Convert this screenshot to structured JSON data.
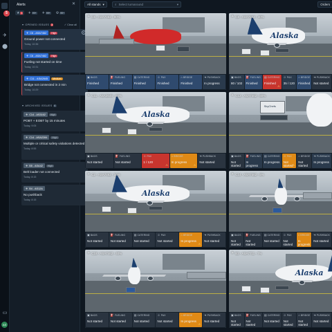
{
  "app": {
    "panel_title": "Alerts"
  },
  "filters": [
    {
      "icon": "star-icon",
      "count": "1",
      "red": true
    },
    {
      "icon": "plane-icon",
      "count": "99+",
      "red": false
    },
    {
      "icon": "plane-icon",
      "count": "99+",
      "red": false
    },
    {
      "icon": "gear-icon",
      "count": "99+",
      "red": false
    }
  ],
  "rail": {
    "badge": "5",
    "avatar": "AS"
  },
  "opened": {
    "title": "OPENED ISSUES",
    "count": "3",
    "clear_all": "Clear all",
    "items": [
      {
        "tag": "C6 - ASA7462",
        "priority": "High",
        "priority_class": "high",
        "message": "Ground power not connected",
        "time": "Today, 10:36"
      },
      {
        "tag": "C6 - ASA7462",
        "priority": "High",
        "priority_class": "high",
        "message": "Fueling not started on time",
        "time": "Today, 10:31"
      },
      {
        "tag": "C11 - ASA2645",
        "priority": "Medium",
        "priority_class": "medium",
        "message": "Bridge not connected in 2 min",
        "time": "Today, 10:29"
      }
    ]
  },
  "archived": {
    "title": "ARCHIVED ISSUES",
    "count": "6",
    "items": [
      {
        "tag": "C14 - AS3162",
        "priority": "High",
        "message": "POBT + EOBT by 15 minutes",
        "time": "Today, 9:05"
      },
      {
        "tag": "C14 - ASA2284",
        "priority": "High",
        "message": "Multiple or critical safety violations detected",
        "time": "Today, 8:55"
      },
      {
        "tag": "B5 - ASA42",
        "priority": "High",
        "message": "Belt loader not connected",
        "time": "Today, 8:15"
      },
      {
        "tag": "B4 - AS12A",
        "priority": "",
        "message": "No pushback",
        "time": "Today, 8:15"
      }
    ]
  },
  "topbar": {
    "stands": "All stands",
    "search_placeholder": "Select turnaround",
    "order": "Orders"
  },
  "tiles": [
    {
      "label": "C6 - ASA7462 - 90%",
      "scene": "red",
      "statuses": [
        {
          "key": "BAGS",
          "value": "Finished",
          "state": "finished"
        },
        {
          "key": "FUELING",
          "value": "Finished",
          "state": "finished"
        },
        {
          "key": "CATERING",
          "value": "Finished",
          "state": "finished"
        },
        {
          "key": "PAX",
          "value": "Finished",
          "state": "finished"
        },
        {
          "key": "BRIDGE",
          "value": "Finished",
          "state": "finished"
        },
        {
          "key": "PUSHBACK",
          "value": "In progress",
          "state": "inprogress"
        }
      ]
    },
    {
      "label": "C8 - ASA7462 - 40%",
      "scene": "alaska-tail",
      "statuses": [
        {
          "key": "BAGS",
          "value": "80 / 102",
          "state": "inprogress"
        },
        {
          "key": "FUELING",
          "value": "Finished",
          "state": "finished"
        },
        {
          "key": "CATERING",
          "value": "Finished",
          "state": "alert"
        },
        {
          "key": "PAX",
          "value": "35 / 120",
          "state": "inprogress"
        },
        {
          "key": "BRIDGE",
          "value": "Finished",
          "state": "finished"
        },
        {
          "key": "PUSHBACK",
          "value": "Not started",
          "state": "notstarted"
        }
      ]
    },
    {
      "label": "C11 - ASA2645 - 60%",
      "scene": "alaska",
      "statuses": [
        {
          "key": "BAGS",
          "value": "Not started",
          "state": "notstarted"
        },
        {
          "key": "FUELING",
          "value": "Not started",
          "state": "notstarted"
        },
        {
          "key": "PAX",
          "value": "1 / 120",
          "state": "alert"
        },
        {
          "key": "BRIDGE",
          "value": "In progress",
          "state": "warn"
        },
        {
          "key": "PUSHBACK",
          "value": "Not started",
          "state": "notstarted"
        }
      ]
    },
    {
      "label": "C12 - ASA7462 - 80%",
      "scene": "skychef",
      "statuses": [
        {
          "key": "BAGS",
          "value": "Not started",
          "state": "notstarted"
        },
        {
          "key": "FUELING",
          "value": "In progress",
          "state": "inprogress"
        },
        {
          "key": "CATERING",
          "value": "In progress",
          "state": "inprogress"
        },
        {
          "key": "PAX",
          "value": "Not started",
          "state": "warn"
        },
        {
          "key": "BRIDGE",
          "value": "Not started",
          "state": "notstarted"
        },
        {
          "key": "PUSHBACK",
          "value": "In progress",
          "state": "inprogress"
        }
      ]
    },
    {
      "label": "C2 - ASA7462 - 34%",
      "scene": "alaska-side",
      "statuses": [
        {
          "key": "BAGS",
          "value": "Not started",
          "state": "notstarted"
        },
        {
          "key": "FUELING",
          "value": "Not started",
          "state": "notstarted"
        },
        {
          "key": "CATERING",
          "value": "Not started",
          "state": "notstarted"
        },
        {
          "key": "PAX",
          "value": "Not started",
          "state": "notstarted"
        },
        {
          "key": "BRIDGE",
          "value": "In progress",
          "state": "warn"
        },
        {
          "key": "PUSHBACK",
          "value": "Not started",
          "state": "notstarted"
        }
      ]
    },
    {
      "label": "C14 - ASA7462 - 5%",
      "scene": "front",
      "statuses": [
        {
          "key": "BAGS",
          "value": "Not started",
          "state": "notstarted"
        },
        {
          "key": "FUELING",
          "value": "Not started",
          "state": "notstarted"
        },
        {
          "key": "CATERING",
          "value": "Not started",
          "state": "notstarted"
        },
        {
          "key": "PAX",
          "value": "Not started",
          "state": "notstarted"
        },
        {
          "key": "BRIDGE",
          "value": "In progress",
          "state": "warn"
        },
        {
          "key": "PUSHBACK",
          "value": "Not started",
          "state": "notstarted"
        }
      ]
    },
    {
      "label": "C18 - ASA7462 - 40%",
      "scene": "front-left",
      "statuses": [
        {
          "key": "BAGS",
          "value": "Not started",
          "state": "notstarted"
        },
        {
          "key": "FUELING",
          "value": "Not started",
          "state": "notstarted"
        },
        {
          "key": "CATERING",
          "value": "Not started",
          "state": "notstarted"
        },
        {
          "key": "PAX",
          "value": "Not started",
          "state": "notstarted"
        },
        {
          "key": "BRIDGE",
          "value": "In progress",
          "state": "warn"
        },
        {
          "key": "PUSHBACK",
          "value": "Not started",
          "state": "notstarted"
        }
      ]
    },
    {
      "label": "B2 - ASA7711 - 7%",
      "scene": "alaska-right",
      "statuses": [
        {
          "key": "BAGS",
          "value": "Not started",
          "state": "notstarted"
        },
        {
          "key": "FUELING",
          "value": "Not started",
          "state": "notstarted"
        },
        {
          "key": "CATERING",
          "value": "Not started",
          "state": "notstarted"
        },
        {
          "key": "PAX",
          "value": "Not started",
          "state": "notstarted"
        },
        {
          "key": "BRIDGE",
          "value": "Not started",
          "state": "notstarted"
        },
        {
          "key": "PUSHBACK",
          "value": "Not started",
          "state": "notstarted"
        }
      ]
    }
  ],
  "livery_text": "Alaska",
  "skychef_text": "SkyChefs",
  "colors": {
    "finished": "#2f4a6e",
    "alert": "#c8352e",
    "warn": "#e08a16",
    "accent": "#2f6fd6"
  }
}
